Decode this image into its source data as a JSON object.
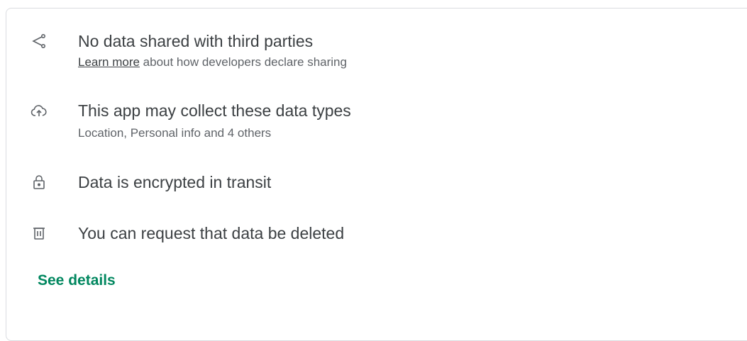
{
  "items": [
    {
      "icon": "share-icon",
      "title": "No data shared with third parties",
      "subtitle_link": "Learn more",
      "subtitle_rest": " about how developers declare sharing"
    },
    {
      "icon": "cloud-upload-icon",
      "title": "This app may collect these data types",
      "subtitle": "Location, Personal info and 4 others"
    },
    {
      "icon": "lock-icon",
      "title": "Data is encrypted in transit"
    },
    {
      "icon": "trash-icon",
      "title": "You can request that data be deleted"
    }
  ],
  "see_details_label": "See details",
  "colors": {
    "accent": "#01875f",
    "text_primary": "#3c4043",
    "text_secondary": "#5f6368",
    "border": "#dadce0"
  }
}
